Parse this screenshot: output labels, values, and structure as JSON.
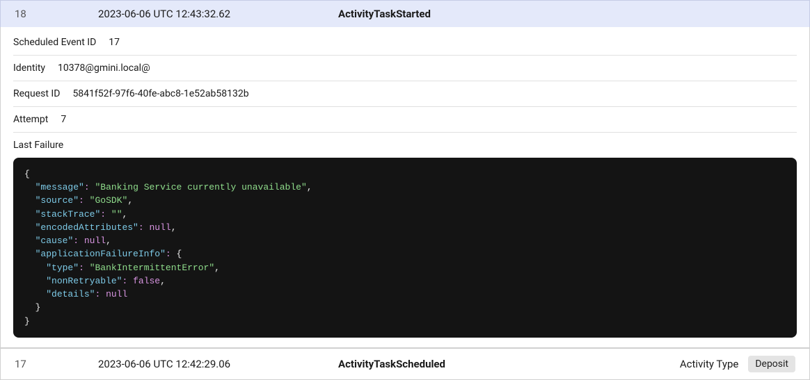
{
  "events": [
    {
      "id": "18",
      "timestamp": "2023-06-06 UTC 12:43:32.62",
      "type": "ActivityTaskStarted",
      "details": {
        "scheduled_event_id": {
          "label": "Scheduled Event ID",
          "value": "17"
        },
        "identity": {
          "label": "Identity",
          "value": "10378@gmini.local@"
        },
        "request_id": {
          "label": "Request ID",
          "value": "5841f52f-97f6-40fe-abc8-1e52ab58132b"
        },
        "attempt": {
          "label": "Attempt",
          "value": "7"
        },
        "last_failure": {
          "label": "Last Failure"
        }
      },
      "failure_json": {
        "keys": {
          "message": "message",
          "source": "source",
          "stackTrace": "stackTrace",
          "encodedAttributes": "encodedAttributes",
          "cause": "cause",
          "applicationFailureInfo": "applicationFailureInfo",
          "type": "type",
          "nonRetryable": "nonRetryable",
          "details": "details"
        },
        "values": {
          "message": "Banking Service currently unavailable",
          "source": "GoSDK",
          "stackTrace": "",
          "encodedAttributes": "null",
          "cause": "null",
          "type": "BankIntermittentError",
          "nonRetryable": "false",
          "details": "null"
        }
      }
    },
    {
      "id": "17",
      "timestamp": "2023-06-06 UTC 12:42:29.06",
      "type": "ActivityTaskScheduled",
      "activity_type_label": "Activity Type",
      "activity_type_value": "Deposit"
    }
  ]
}
